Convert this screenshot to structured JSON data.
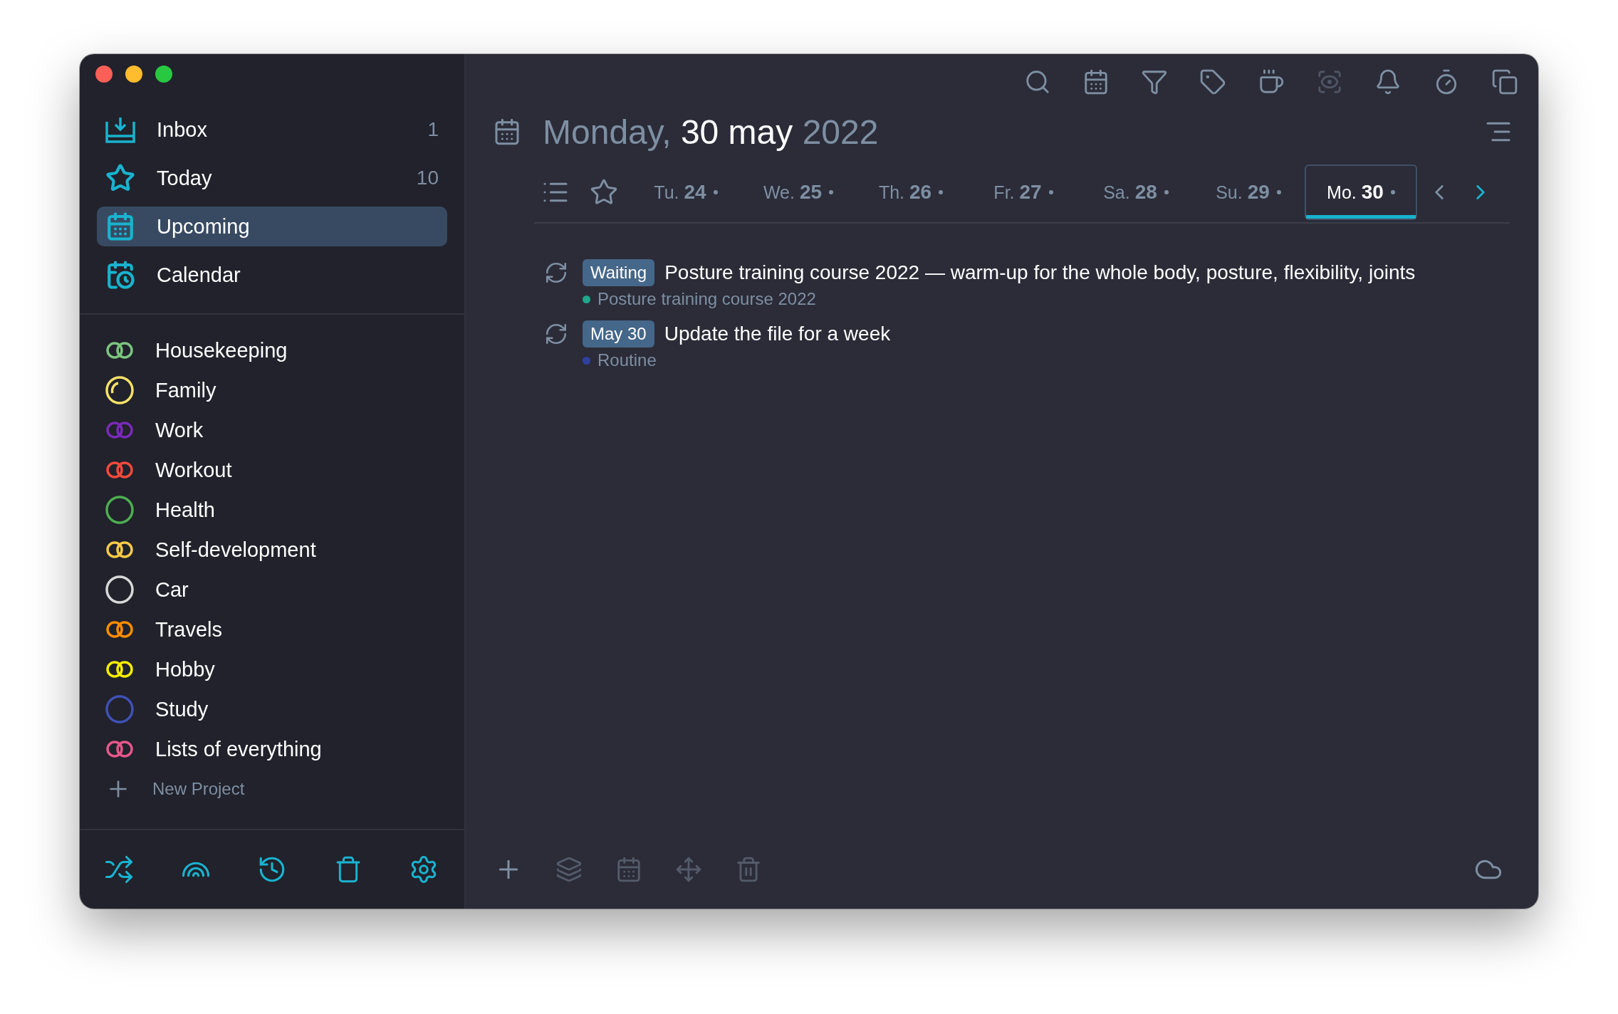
{
  "sidebar": {
    "nav": [
      {
        "kind": "inbox",
        "label": "Inbox",
        "count": "1",
        "selected": false
      },
      {
        "kind": "today",
        "label": "Today",
        "count": "10",
        "selected": false
      },
      {
        "kind": "upcoming",
        "label": "Upcoming",
        "selected": true
      },
      {
        "kind": "calendar",
        "label": "Calendar",
        "selected": false
      }
    ],
    "projects": [
      {
        "name": "Housekeeping",
        "kind": "double",
        "color": "#7cc47f"
      },
      {
        "name": "Family",
        "kind": "partial",
        "color": "#f5e06a"
      },
      {
        "name": "Work",
        "kind": "double",
        "color": "#7a2ab8"
      },
      {
        "name": "Workout",
        "kind": "double",
        "color": "#f04a3c"
      },
      {
        "name": "Health",
        "kind": "single",
        "color": "#4caf50"
      },
      {
        "name": "Self-development",
        "kind": "double",
        "color": "#f7c948"
      },
      {
        "name": "Car",
        "kind": "single",
        "color": "#d8d8d8"
      },
      {
        "name": "Travels",
        "kind": "double",
        "color": "#fb8c00"
      },
      {
        "name": "Hobby",
        "kind": "double",
        "color": "#f5ec00"
      },
      {
        "name": "Study",
        "kind": "single",
        "color": "#3f51b5"
      },
      {
        "name": "Lists of everything",
        "kind": "double",
        "color": "#e5578a"
      }
    ],
    "new_project": "New Project"
  },
  "header": {
    "weekday": "Monday,",
    "date": "30 may",
    "year": "2022"
  },
  "days": [
    {
      "weekday": "Tu.",
      "day": "24",
      "selected": false
    },
    {
      "weekday": "We.",
      "day": "25",
      "selected": false
    },
    {
      "weekday": "Th.",
      "day": "26",
      "selected": false
    },
    {
      "weekday": "Fr.",
      "day": "27",
      "selected": false
    },
    {
      "weekday": "Sa.",
      "day": "28",
      "selected": false
    },
    {
      "weekday": "Su.",
      "day": "29",
      "selected": false
    },
    {
      "weekday": "Mo.",
      "day": "30",
      "selected": true
    }
  ],
  "tasks": [
    {
      "badge": "Waiting",
      "title": "Posture training course 2022 — warm-up for the whole body, posture, flexibility, joints",
      "project": "Posture training course 2022",
      "color": "#1fa88a"
    },
    {
      "badge": "May 30",
      "title": "Update the file for a week",
      "project": "Routine",
      "color": "#3040a0"
    }
  ]
}
